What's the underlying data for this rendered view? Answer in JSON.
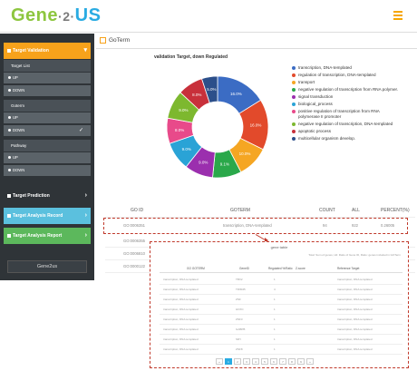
{
  "header": {
    "logo_left": "Gene",
    "logo_dot": "·2·",
    "logo_right": "US",
    "menu_icon": "hamburger-icon"
  },
  "sidebar": {
    "target_validation": "Target Validation",
    "target_list": "Target List",
    "target_list_items": [
      "UP",
      "DOWN"
    ],
    "goterm": "Goterm",
    "goterm_items": [
      "UP",
      "DOWN"
    ],
    "pathway": "Pathway",
    "pathway_items": [
      "UP",
      "DOWN"
    ],
    "target_prediction": "Target Prediction",
    "analysis_record_1": "Target Analysis Record",
    "analysis_record_2": "Target Analysis Report",
    "footer": "Gene2us"
  },
  "content": {
    "title": "GoTerm",
    "chart_title": "validation Target, down Regulated"
  },
  "chart_data": {
    "type": "pie",
    "title": "validation Target, down Regulated",
    "categories": [
      "transcription, DNA-templated",
      "regulation of transcription, DNA-templated",
      "transport",
      "negative regulation of transcription from RNA polymer.",
      "signal transduction",
      "biological_process",
      "positive regulation of transcription from RNA polymerase II promoter",
      "negative regulation of transcription, DNA-templated",
      "apoptotic process",
      "multicellular organism develop."
    ],
    "values": [
      16.0,
      16.0,
      10.0,
      9.1,
      9.0,
      9.0,
      8.0,
      9.0,
      8.0,
      5.0
    ],
    "labels": [
      "16.0%",
      "16.0%",
      "10.0%",
      "9.1%",
      "9.0%",
      "9.0%",
      "8.0%",
      "9.0%",
      "8.0%",
      "5.0%"
    ],
    "colors": [
      "#3b6cc4",
      "#e24a2b",
      "#f5a623",
      "#2aa84a",
      "#9b2fae",
      "#2aa3d6",
      "#e84a8a",
      "#7db82f",
      "#c8303b",
      "#2c4f8a"
    ]
  },
  "table": {
    "headers": [
      "GO ID",
      "GOTERM",
      "COUNT",
      "ALL",
      "PERCENT(%)"
    ],
    "rows": [
      [
        "GO:0006351",
        "transcription, DNA-templated",
        "94",
        "922",
        "0.26005"
      ],
      [
        "GO:0006355",
        "",
        "",
        "",
        ""
      ],
      [
        "GO:0006810",
        "",
        "",
        "",
        ""
      ],
      [
        "GO:0000122",
        "",
        "",
        "",
        ""
      ]
    ]
  },
  "popup": {
    "title": "gene table",
    "note": "Total: Sum of genes, Hit: Ratio of Gene ID, Ratio: genes included in GOTerm",
    "headers": [
      "GO GOTERM",
      "GeneID",
      "Regulated %/Ratio",
      "Z-score",
      "Reference Target"
    ],
    "rows": [
      [
        "transcription, DNA-templated",
        "TBX2",
        "1",
        "transcription, DNA-templated"
      ],
      [
        "transcription, DNA-templated",
        "TRIM45",
        "4",
        "transcription, DNA-templated"
      ],
      [
        "transcription, DNA-templated",
        "ZNF",
        "1",
        "transcription, DNA-templated"
      ],
      [
        "transcription, DNA-templated",
        "HOXC",
        "1",
        "transcription, DNA-templated"
      ],
      [
        "transcription, DNA-templated",
        "ZNF3",
        "1",
        "transcription, DNA-templated"
      ],
      [
        "transcription, DNA-templated",
        "GABPB",
        "1",
        "transcription, DNA-templated"
      ],
      [
        "transcription, DNA-templated",
        "SRY",
        "1",
        "transcription, DNA-templated"
      ],
      [
        "transcription, DNA-templated",
        "ZNF8",
        "1",
        "transcription, DNA-templated"
      ]
    ],
    "pager": [
      "«",
      "1",
      "2",
      "3",
      "4",
      "5",
      "6",
      "7",
      "8",
      "9",
      "»"
    ]
  }
}
